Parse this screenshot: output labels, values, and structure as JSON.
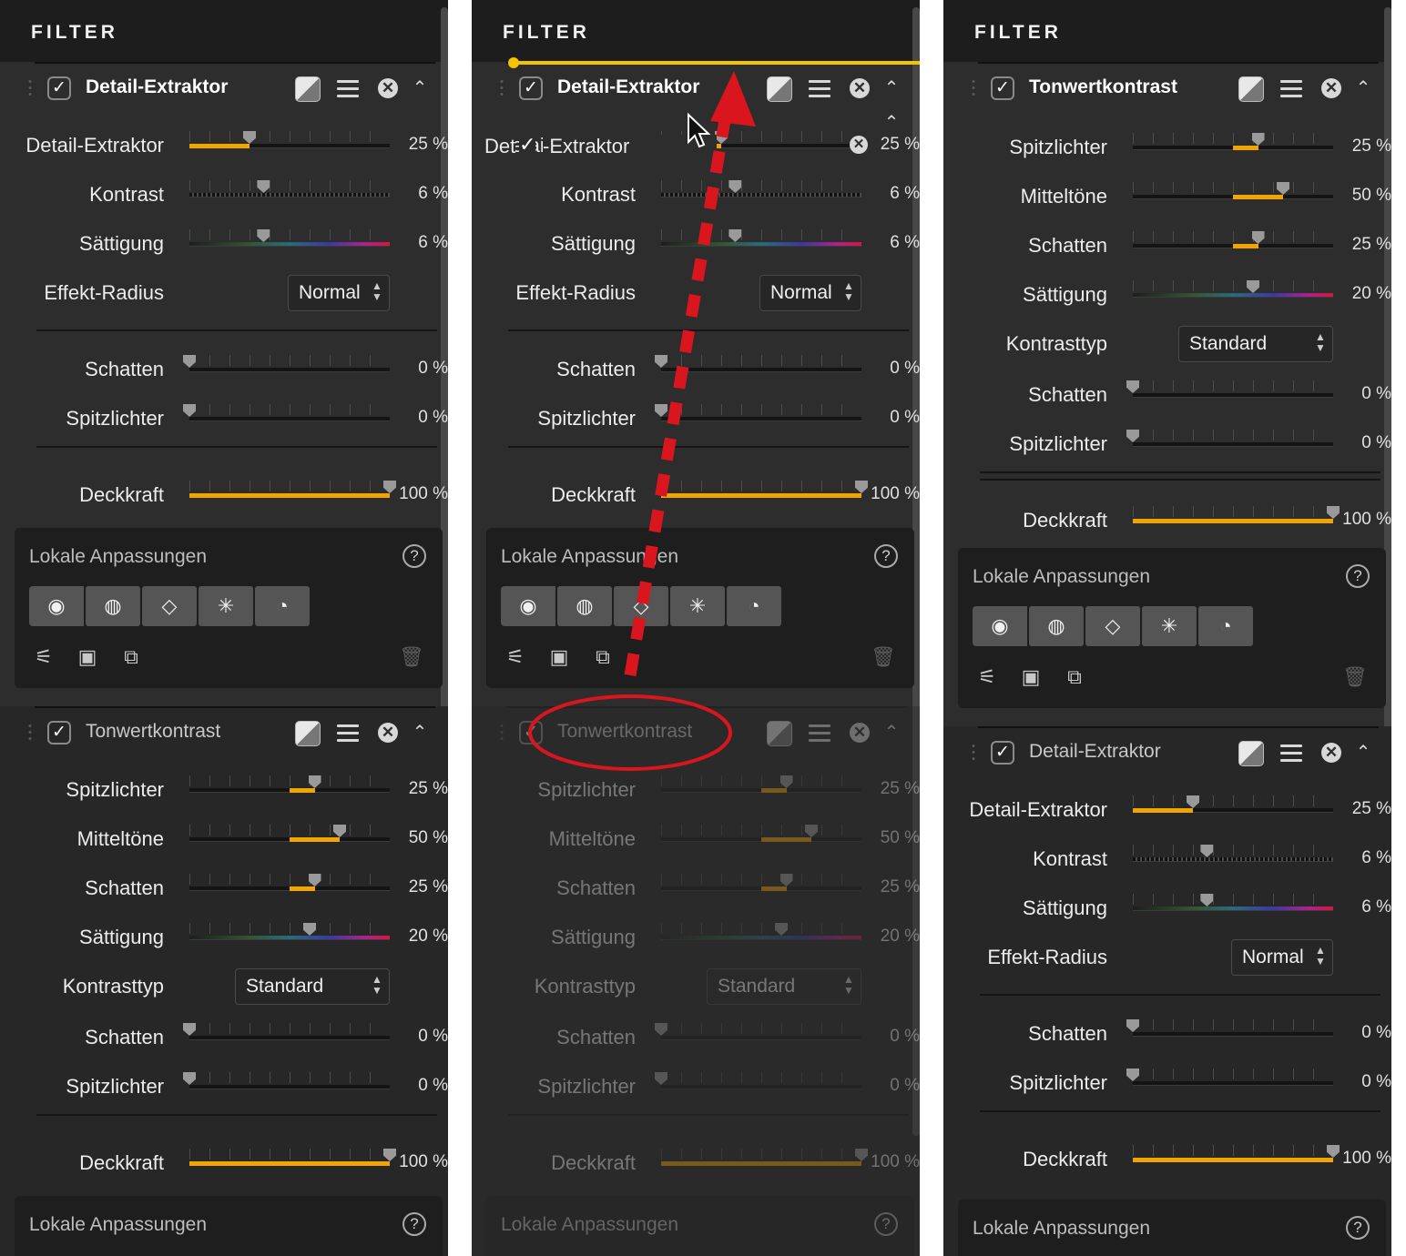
{
  "panel_title": "FILTER",
  "icons": {
    "check": "✓",
    "close": "✕",
    "collapse": "⌃",
    "help": "?",
    "sel_up": "▲",
    "sel_down": "▼",
    "trash": "🗑",
    "tools": [
      "◉",
      "◍",
      "◇",
      "✳",
      "◔"
    ],
    "bottom": [
      "⚟",
      "▣",
      "⧉"
    ]
  },
  "colors": {
    "accent": "#f0a500",
    "insert_line": "#f5c400",
    "annotation_red": "#d9161e",
    "panel_bg": "#2d2d2d"
  },
  "detail": {
    "name": "Detail-Extraktor",
    "rows": [
      {
        "label": "Detail-Extraktor",
        "value": "25 %",
        "pct": 0.3,
        "fill_from": 0,
        "track": "plain"
      },
      {
        "label": "Kontrast",
        "value": "6 %",
        "pct": 0.37,
        "track": "checker"
      },
      {
        "label": "Sättigung",
        "value": "6 %",
        "pct": 0.37,
        "track": "rainbow"
      }
    ],
    "radius_label": "Effekt-Radius",
    "radius_value": "Normal",
    "tone_rows": [
      {
        "label": "Schatten",
        "value": "0 %",
        "pct": 0.0
      },
      {
        "label": "Spitzlichter",
        "value": "0 %",
        "pct": 0.0
      }
    ],
    "opacity": {
      "label": "Deckkraft",
      "value": "100 %",
      "pct": 1.0
    }
  },
  "tonwert": {
    "name": "Tonwertkontrast",
    "rows": [
      {
        "label": "Spitzlichter",
        "value": "25 %",
        "pct": 0.625,
        "fill_from": 0.5,
        "track": "plain"
      },
      {
        "label": "Mitteltöne",
        "value": "50 %",
        "pct": 0.75,
        "fill_from": 0.5,
        "track": "plain"
      },
      {
        "label": "Schatten",
        "value": "25 %",
        "pct": 0.625,
        "fill_from": 0.5,
        "track": "plain"
      },
      {
        "label": "Sättigung",
        "value": "20 %",
        "pct": 0.6,
        "track": "rainbow"
      }
    ],
    "type_label": "Kontrasttyp",
    "type_value": "Standard",
    "tone_rows": [
      {
        "label": "Schatten",
        "value": "0 %",
        "pct": 0.0
      },
      {
        "label": "Spitzlichter",
        "value": "0 %",
        "pct": 0.0
      }
    ],
    "opacity": {
      "label": "Deckkraft",
      "value": "100 %",
      "pct": 1.0
    }
  },
  "local": {
    "title": "Lokale Anpassungen"
  },
  "drag_ghost": {
    "prefix": "Det",
    "overlap_text": "-Extraktor",
    "ghost_text": "Tonwertkontrast"
  }
}
